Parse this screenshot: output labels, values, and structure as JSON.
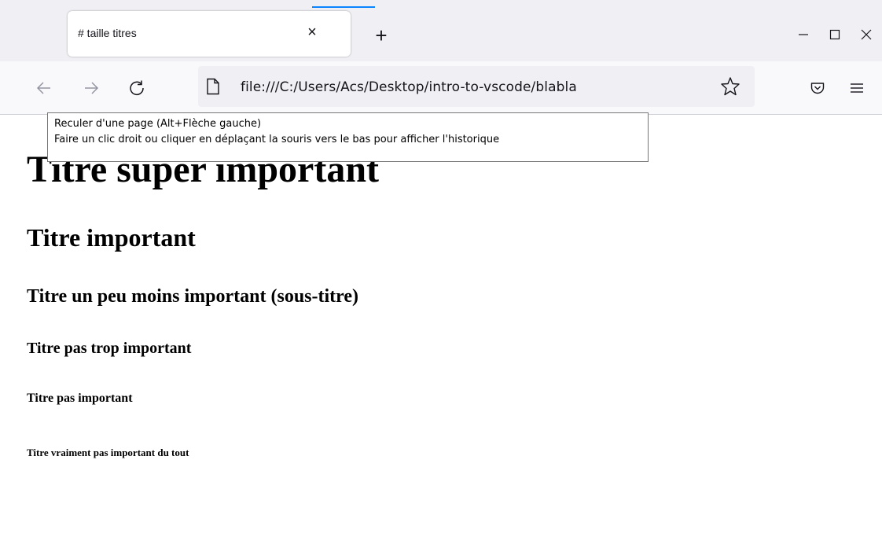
{
  "tab": {
    "title": "# taille titres",
    "close_label": "×",
    "new_tab_label": "+"
  },
  "window_controls": {
    "minimize": "—",
    "maximize": "☐",
    "close": "✕"
  },
  "navbar": {
    "url": "file:///C:/Users/Acs/Desktop/intro-to-vscode/blabla",
    "icons": [
      "back-arrow-icon",
      "forward-arrow-icon",
      "reload-icon",
      "page-icon",
      "star-icon",
      "pocket-icon",
      "hamburger-menu-icon"
    ]
  },
  "tooltip": {
    "line1": "Reculer d'une page (Alt+Flèche gauche)",
    "line2": "Faire un clic droit ou cliquer en déplaçant la souris vers le bas pour afficher l'historique"
  },
  "content": {
    "h1": "Titre super important",
    "h2": "Titre important",
    "h3": "Titre un peu moins important (sous-titre)",
    "h4": "Titre pas trop important",
    "h5": "Titre pas important",
    "h6": "Titre vraiment pas important du tout"
  },
  "colors": {
    "tabstrip_bg": "#f0f0f4",
    "navbar_bg": "#f9f9fb",
    "accent": "#0a84ff"
  }
}
